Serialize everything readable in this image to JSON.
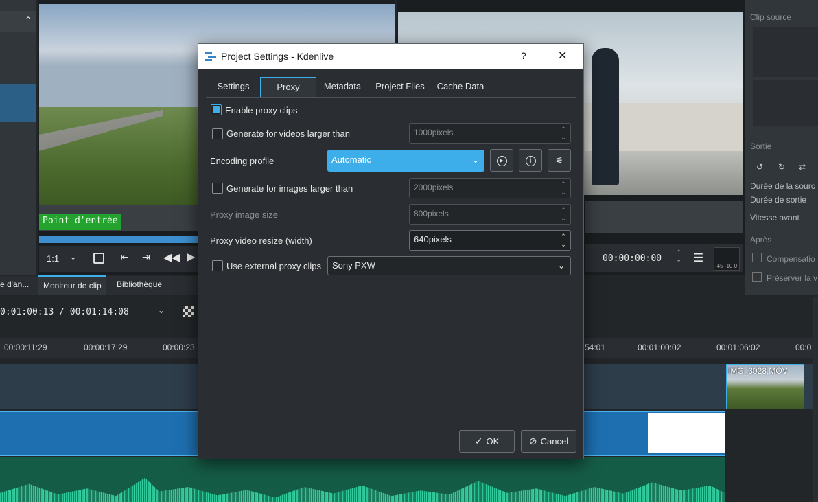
{
  "background": {
    "left_monitor_overlay": "Point d'entrée",
    "left_monitor_zoom": "1:1",
    "right_timecode": "00:00:00:00",
    "right_meter_label": "-45 -10 0",
    "bottom_tabs": [
      "e d'an...",
      "Moniteur de clip",
      "Bibliothèque"
    ],
    "timeline_position": "0:01:00:13 / 00:01:14:08",
    "ruler_ticks": [
      "00:00:11:29",
      "00:00:17:29",
      "00:00:23",
      "54:01",
      "00:01:00:02",
      "00:01:06:02",
      "00:0"
    ],
    "clip_name": "IMG_3028.MOV",
    "right_panel": {
      "clip_source": "Clip source",
      "sortie": "Sortie",
      "duree_source": "Durée de la sourc",
      "duree_sortie": "Durée de sortie",
      "vitesse_avant": "Vitesse avant",
      "apres": "Après",
      "compensation": "Compensatio",
      "preserver": "Préserver la v"
    }
  },
  "dialog": {
    "title": "Project Settings - Kdenlive",
    "help": "?",
    "close": "✕",
    "tabs": [
      "Settings",
      "Proxy",
      "Metadata",
      "Project Files",
      "Cache Data"
    ],
    "active_tab": "Proxy",
    "enable_proxy": "Enable proxy clips",
    "gen_videos": "Generate for videos larger than",
    "gen_videos_value": "1000pixels",
    "encoding_profile": "Encoding profile",
    "encoding_value": "Automatic",
    "gen_images": "Generate for images larger than",
    "gen_images_value": "2000pixels",
    "proxy_image_size": "Proxy image size",
    "proxy_image_size_value": "800pixels",
    "proxy_video_resize": "Proxy video resize (width)",
    "proxy_video_resize_value": "640pixels",
    "use_external": "Use external proxy clips",
    "external_value": "Sony PXW",
    "ok": "OK",
    "cancel": "Cancel"
  },
  "colors": {
    "accent": "#3daee9",
    "dialog_bg": "#2a2e32",
    "titlebar": "#ffffff",
    "clip_blue": "#1e6fb0",
    "audio_green": "#2aa37f"
  }
}
